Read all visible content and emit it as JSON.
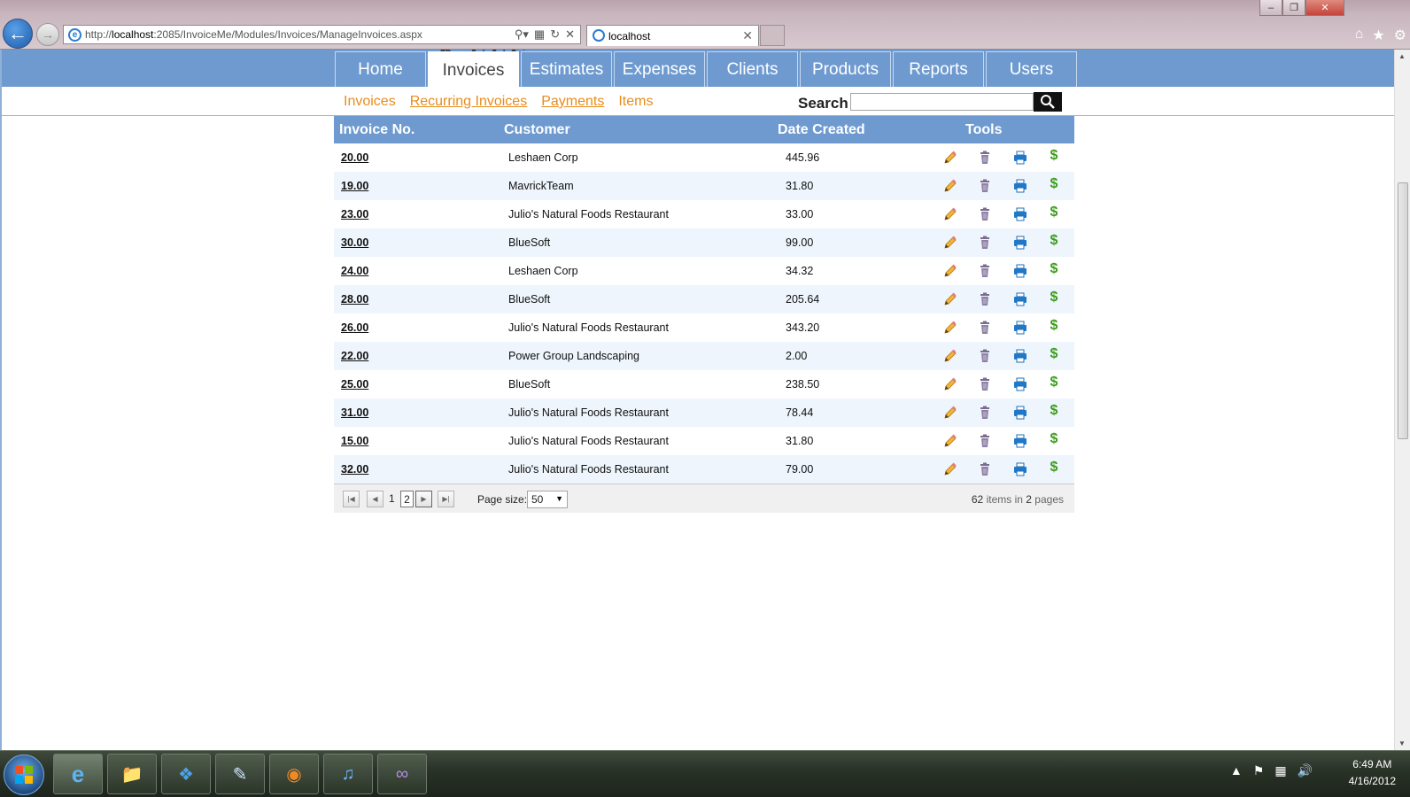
{
  "browser": {
    "url_prefix": "http://",
    "url_host": "localhost",
    "url_rest": ":2085/InvoiceMe/Modules/Invoices/ManageInvoices.aspx",
    "active_tab_title": "localhost"
  },
  "nav": {
    "tabs": [
      {
        "label": "Home",
        "active": false
      },
      {
        "label": "Invoices",
        "active": true
      },
      {
        "label": "Estimates",
        "active": false
      },
      {
        "label": "Expenses",
        "active": false
      },
      {
        "label": "Clients",
        "active": false
      },
      {
        "label": "Products",
        "active": false
      },
      {
        "label": "Reports",
        "active": false
      },
      {
        "label": "Users",
        "active": false
      }
    ]
  },
  "subnav": {
    "links": [
      {
        "label": "Invoices",
        "underlined": false
      },
      {
        "label": "Recurring Invoices",
        "underlined": true
      },
      {
        "label": "Payments",
        "underlined": true
      },
      {
        "label": "Items",
        "underlined": false
      }
    ],
    "search_label": "Search",
    "search_value": ""
  },
  "grid": {
    "headers": {
      "invoice_no": "Invoice No.",
      "customer": "Customer",
      "date_created": "Date Created",
      "tools": "Tools"
    },
    "rows": [
      {
        "invoice_no": "20.00",
        "customer": "Leshaen Corp",
        "date_created": "445.96"
      },
      {
        "invoice_no": "19.00",
        "customer": "MavrickTeam",
        "date_created": "31.80"
      },
      {
        "invoice_no": "23.00",
        "customer": "Julio's Natural Foods Restaurant",
        "date_created": "33.00"
      },
      {
        "invoice_no": "30.00",
        "customer": "BlueSoft",
        "date_created": "99.00"
      },
      {
        "invoice_no": "24.00",
        "customer": "Leshaen Corp",
        "date_created": "34.32"
      },
      {
        "invoice_no": "28.00",
        "customer": "BlueSoft",
        "date_created": "205.64"
      },
      {
        "invoice_no": "26.00",
        "customer": "Julio's Natural Foods Restaurant",
        "date_created": "343.20"
      },
      {
        "invoice_no": "22.00",
        "customer": "Power Group Landscaping",
        "date_created": "2.00"
      },
      {
        "invoice_no": "25.00",
        "customer": "BlueSoft",
        "date_created": "238.50"
      },
      {
        "invoice_no": "31.00",
        "customer": "Julio's Natural Foods Restaurant",
        "date_created": "78.44"
      },
      {
        "invoice_no": "15.00",
        "customer": "Julio's Natural Foods Restaurant",
        "date_created": "31.80"
      },
      {
        "invoice_no": "32.00",
        "customer": "Julio's Natural Foods Restaurant",
        "date_created": "79.00"
      }
    ],
    "tool_icons": [
      "pencil-icon",
      "trash-icon",
      "printer-icon",
      "dollar-icon"
    ]
  },
  "pager": {
    "pages": [
      "1",
      "2"
    ],
    "current_page": "2",
    "page_size_label": "Page size:",
    "page_size_value": "50",
    "summary_count": "62",
    "summary_items_text": "items in",
    "summary_pages": "2",
    "summary_pages_text": "pages"
  },
  "taskbar": {
    "time": "6:49 AM",
    "date": "4/16/2012"
  },
  "colors": {
    "nav_blue": "#6e9ad0",
    "link_orange": "#e88c1a",
    "row_alt": "#eef5fc",
    "pay_green": "#3c9d1a"
  }
}
